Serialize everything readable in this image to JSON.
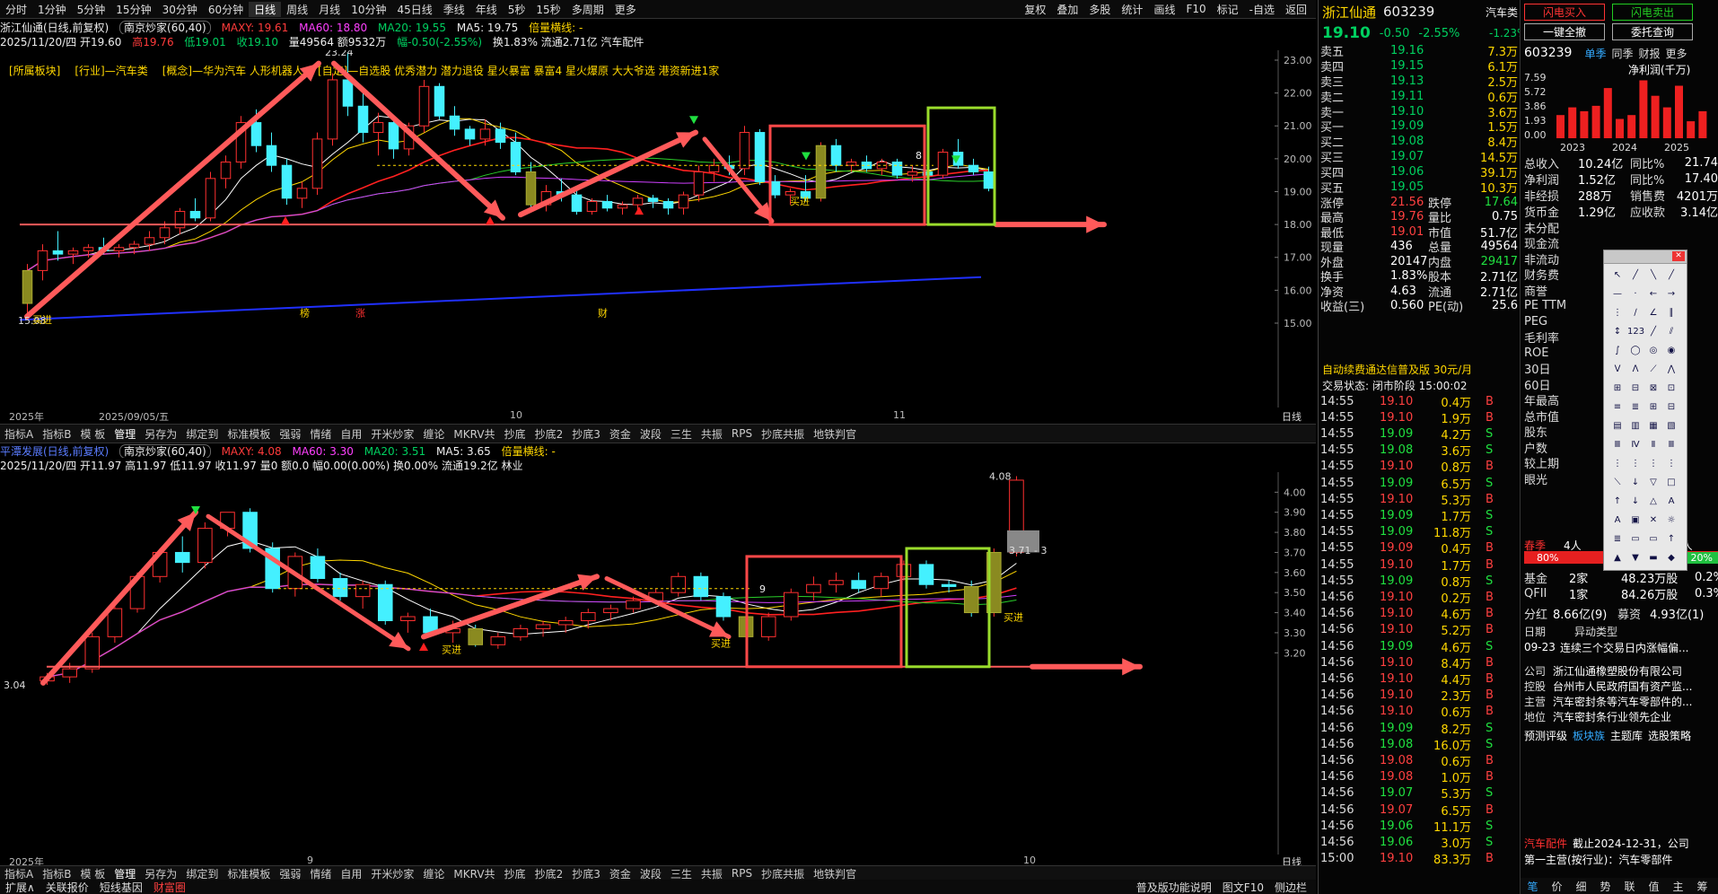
{
  "toolbar": {
    "periods": [
      "分时",
      "1分钟",
      "5分钟",
      "15分钟",
      "30分钟",
      "60分钟",
      "日线",
      "周线",
      "月线",
      "10分钟",
      "45日线",
      "季线",
      "年线",
      "5秒",
      "15秒",
      "多周期",
      "更多"
    ],
    "active_period": "日线",
    "right_items": [
      "复权",
      "叠加",
      "多股",
      "统计",
      "画线",
      "F10",
      "标记",
      "-自选",
      "返回"
    ]
  },
  "upper": {
    "title": "浙江仙通(日线,前复权)",
    "pill": "南京炒家(60,40)",
    "maxy": "MAXY: 19.61",
    "ma60": "MA60: 18.80",
    "ma20": "MA20: 19.55",
    "ma5": "MA5: 19.75",
    "beiliang": "倍量横线: -",
    "ohlc": "2025/11/20/四 开19.60",
    "high": "高19.76",
    "low": "低19.01",
    "close": "收19.10",
    "vol": "量49564 额9532万",
    "chg": "幅-0.50(-2.55%)",
    "extra": "换1.83% 流通2.71亿 汽车配件",
    "tags": [
      "[所属板块]",
      "[行业]—汽车类",
      "[概念]—华为汽车 人形机器人",
      "[自定]—自选股 优秀潜力 潜力退役 星火暴富 暴富4 星火爆原 大大爷选 港资新进1家"
    ],
    "yticks": [
      "23.00",
      "22.00",
      "21.00",
      "20.00",
      "19.00",
      "18.00",
      "17.00",
      "16.00",
      "15.00"
    ],
    "xlabels": [
      "2025年",
      "2025/09/05/五",
      "10",
      "11"
    ],
    "hi_label": "23.24",
    "lo_label": "15.08",
    "buy": "买进",
    "markers": [
      "榜",
      "涨",
      "财"
    ],
    "num8": "8",
    "day_label": "日线"
  },
  "tabs": [
    "指标A",
    "指标B",
    "模 板",
    "管理",
    "另存为",
    "绑定到",
    "标准模板",
    "强弱",
    "情绪",
    "自用",
    "开米炒家",
    "缠论",
    "MKRV共",
    "抄底",
    "抄底2",
    "抄底3",
    "资金",
    "波段",
    "三生",
    "共振",
    "RPS",
    "抄底共振",
    "地铁判官"
  ],
  "tabs_active": "管理",
  "lower": {
    "title": "平潭发展(日线,前复权)",
    "pill": "南京炒家(60,40)",
    "maxy": "MAXY: 4.08",
    "ma60": "MA60: 3.30",
    "ma20": "MA20: 3.51",
    "ma5": "MA5: 3.65",
    "beiliang": "倍量横线: -",
    "ohlc": "2025/11/20/四 开11.97 高11.97 低11.97 收11.97 量0 额0.0 幅0.00(0.00%) 换0.00% 流通19.2亿 林业",
    "yticks": [
      "4.00",
      "3.90",
      "3.80",
      "3.70",
      "3.60",
      "3.50",
      "3.40",
      "3.30",
      "3.20"
    ],
    "xlabels": [
      "2025年",
      "9",
      "10"
    ],
    "hi_label": "4.08",
    "lo_label": "3.04",
    "r_label": "3.71 - 3",
    "buy": "买进",
    "num9": "9",
    "day_label": "日线"
  },
  "bottom": {
    "items": [
      "扩展∧",
      "关联报价",
      "短线基因",
      "财富圈"
    ],
    "right": [
      "普及版功能说明",
      "图文F10",
      "侧边栏"
    ]
  },
  "quote": {
    "name": "浙江仙通",
    "code": "603239",
    "sector": "汽车类",
    "price": "19.10",
    "change": "-0.50",
    "pct": "-2.55%",
    "sector_pct": "-1.23%",
    "asks": [
      [
        "卖五",
        "19.16",
        "7.3万"
      ],
      [
        "卖四",
        "19.15",
        "6.1万"
      ],
      [
        "卖三",
        "19.13",
        "2.5万"
      ],
      [
        "卖二",
        "19.11",
        "0.6万"
      ],
      [
        "卖一",
        "19.10",
        "3.6万"
      ]
    ],
    "bids": [
      [
        "买一",
        "19.09",
        "1.5万"
      ],
      [
        "买二",
        "19.08",
        "8.4万"
      ],
      [
        "买三",
        "19.07",
        "14.5万"
      ],
      [
        "买四",
        "19.06",
        "39.1万"
      ],
      [
        "买五",
        "19.05",
        "10.3万"
      ]
    ],
    "stats": [
      [
        "涨停",
        "21.56",
        "跌停",
        "17.64"
      ],
      [
        "最高",
        "19.76",
        "量比",
        "0.75"
      ],
      [
        "最低",
        "19.01",
        "市值",
        "51.7亿"
      ],
      [
        "现量",
        "436",
        "总量",
        "49564"
      ],
      [
        "外盘",
        "20147",
        "内盘",
        "29417"
      ],
      [
        "换手",
        "1.83%",
        "股本",
        "2.71亿"
      ],
      [
        "净资",
        "4.63",
        "流通",
        "2.71亿"
      ],
      [
        "收益(三)",
        "0.560",
        "PE(动)",
        "25.6"
      ]
    ],
    "ad": "自动续费通达信普及版 30元/月",
    "status": "交易状态: 闭市阶段 15:00:02",
    "ticks": [
      [
        "14:55",
        "19.10",
        "0.4万",
        "B"
      ],
      [
        "14:55",
        "19.10",
        "1.9万",
        "B"
      ],
      [
        "14:55",
        "19.09",
        "4.2万",
        "S"
      ],
      [
        "14:55",
        "19.08",
        "3.6万",
        "S"
      ],
      [
        "14:55",
        "19.10",
        "0.8万",
        "B"
      ],
      [
        "14:55",
        "19.09",
        "6.5万",
        "S"
      ],
      [
        "14:55",
        "19.10",
        "5.3万",
        "B"
      ],
      [
        "14:55",
        "19.09",
        "1.7万",
        "S"
      ],
      [
        "14:55",
        "19.09",
        "11.8万",
        "S"
      ],
      [
        "14:55",
        "19.09",
        "0.4万",
        "B"
      ],
      [
        "14:55",
        "19.10",
        "1.7万",
        "B"
      ],
      [
        "14:55",
        "19.09",
        "0.8万",
        "S"
      ],
      [
        "14:56",
        "19.10",
        "0.2万",
        "B"
      ],
      [
        "14:56",
        "19.10",
        "4.6万",
        "B"
      ],
      [
        "14:56",
        "19.10",
        "5.2万",
        "B"
      ],
      [
        "14:56",
        "19.09",
        "4.6万",
        "S"
      ],
      [
        "14:56",
        "19.10",
        "8.4万",
        "B"
      ],
      [
        "14:56",
        "19.10",
        "4.4万",
        "B"
      ],
      [
        "14:56",
        "19.10",
        "2.3万",
        "B"
      ],
      [
        "14:56",
        "19.10",
        "0.6万",
        "B"
      ],
      [
        "14:56",
        "19.09",
        "8.2万",
        "S"
      ],
      [
        "14:56",
        "19.08",
        "16.0万",
        "S"
      ],
      [
        "14:56",
        "19.08",
        "0.6万",
        "B"
      ],
      [
        "14:56",
        "19.08",
        "1.0万",
        "B"
      ],
      [
        "14:56",
        "19.07",
        "5.3万",
        "S"
      ],
      [
        "14:56",
        "19.07",
        "6.5万",
        "B"
      ],
      [
        "14:56",
        "19.06",
        "11.1万",
        "S"
      ],
      [
        "14:56",
        "19.06",
        "3.0万",
        "S"
      ],
      [
        "15:00",
        "19.10",
        "83.3万",
        "B"
      ]
    ],
    "buttons": [
      "闪电买入",
      "闪电卖出",
      "一键全撤",
      "委托查询"
    ]
  },
  "f10": {
    "code": "603239",
    "tabs": [
      "单季",
      "同季",
      "财报",
      "更多"
    ],
    "chart_title": "净利润(千万)",
    "yvals": [
      "7.59",
      "5.72",
      "3.86",
      "1.93",
      "0.00"
    ],
    "years": [
      "2023",
      "2024",
      "2025"
    ],
    "rows": [
      [
        "总收入",
        "10.24亿",
        "同比%",
        "21.74"
      ],
      [
        "净利润",
        "1.52亿",
        "同比%",
        "17.40"
      ],
      [
        "非经损",
        "288万",
        "销售费",
        "4201万"
      ],
      [
        "货币金",
        "1.29亿",
        "应收款",
        "3.14亿"
      ]
    ],
    "left_labels": [
      "未分配",
      "现金流",
      "非流动",
      "财务费",
      "商誉",
      "PE TTM",
      "PEG",
      "毛利率",
      "ROE",
      "30日",
      "60日",
      "年最高",
      "总市值",
      "股东",
      "户数",
      "较上期",
      "眼光"
    ],
    "misc": [
      "春季",
      "4人",
      "1人",
      "80%",
      "20%"
    ],
    "holders": [
      [
        "基金",
        "2家",
        "48.23万股",
        "0.2%"
      ],
      [
        "QFII",
        "1家",
        "84.26万股",
        "0.3%"
      ]
    ],
    "fenhong": [
      "分红",
      "8.66亿(9)",
      "募资",
      "4.93亿(1)"
    ],
    "event_hdr": [
      "日期",
      "异动类型"
    ],
    "event": [
      "09-23",
      "连续三个交易日内涨幅偏..."
    ],
    "company": [
      [
        "公司",
        "浙江仙通橡塑股份有限公司"
      ],
      [
        "控股",
        "台州市人民政府国有资产监..."
      ],
      [
        "主营",
        "汽车密封条等汽车零部件的..."
      ],
      [
        "地位",
        "汽车密封条行业领先企业"
      ]
    ],
    "rating": [
      "预测评级",
      "板块族",
      "主题库",
      "选股策略"
    ],
    "foot": [
      "汽车配件",
      "截止2024-12-31，公司",
      "第一主营(按行业)：汽车零部件"
    ],
    "bottom_tabs": [
      "笔",
      "价",
      "细",
      "势",
      "联",
      "值",
      "主",
      "筹"
    ]
  },
  "chart_data": [
    {
      "type": "candlestick",
      "title": "浙江仙通(日线,前复权)",
      "ylim": [
        15.0,
        23.3
      ],
      "candles": [
        [
          15.6,
          16.8,
          15.1,
          16.6
        ],
        [
          16.6,
          17.4,
          16.3,
          17.2
        ],
        [
          17.2,
          17.8,
          16.9,
          17.1
        ],
        [
          17.1,
          17.3,
          16.8,
          17.2
        ],
        [
          17.2,
          17.4,
          17.0,
          17.3
        ],
        [
          17.3,
          17.6,
          17.1,
          17.2
        ],
        [
          17.2,
          17.4,
          17.0,
          17.3
        ],
        [
          17.3,
          17.5,
          17.1,
          17.4
        ],
        [
          17.4,
          17.8,
          17.2,
          17.6
        ],
        [
          17.6,
          18.1,
          17.4,
          17.9
        ],
        [
          17.9,
          18.5,
          17.7,
          18.4
        ],
        [
          18.4,
          18.8,
          18.1,
          18.2
        ],
        [
          18.2,
          19.6,
          18.1,
          19.4
        ],
        [
          19.4,
          20.1,
          19.1,
          19.9
        ],
        [
          19.9,
          21.3,
          19.7,
          21.1
        ],
        [
          21.1,
          21.5,
          20.2,
          20.4
        ],
        [
          20.4,
          20.8,
          19.6,
          19.8
        ],
        [
          19.8,
          20.0,
          18.6,
          18.8
        ],
        [
          18.8,
          19.3,
          18.5,
          19.1
        ],
        [
          19.1,
          20.8,
          18.9,
          20.6
        ],
        [
          20.6,
          22.6,
          20.4,
          22.4
        ],
        [
          22.4,
          23.24,
          21.3,
          21.6
        ],
        [
          21.6,
          22.1,
          20.5,
          20.8
        ],
        [
          20.8,
          21.4,
          20.1,
          21.1
        ],
        [
          21.1,
          21.2,
          20.0,
          20.3
        ],
        [
          20.3,
          21.1,
          20.1,
          21.0
        ],
        [
          21.0,
          22.4,
          20.8,
          22.2
        ],
        [
          22.2,
          22.3,
          21.2,
          21.3
        ],
        [
          21.3,
          21.6,
          20.7,
          20.9
        ],
        [
          20.9,
          21.0,
          20.4,
          20.6
        ],
        [
          20.6,
          21.2,
          20.4,
          20.9
        ],
        [
          20.9,
          21.1,
          20.3,
          20.5
        ],
        [
          20.5,
          20.8,
          19.5,
          19.6
        ],
        [
          19.6,
          19.9,
          18.5,
          18.6
        ],
        [
          18.6,
          19.2,
          18.4,
          19.0
        ],
        [
          19.0,
          19.4,
          18.7,
          18.9
        ],
        [
          18.9,
          19.1,
          18.3,
          18.4
        ],
        [
          18.4,
          18.8,
          18.3,
          18.7
        ],
        [
          18.7,
          18.9,
          18.4,
          18.5
        ],
        [
          18.5,
          18.7,
          18.3,
          18.6
        ],
        [
          18.6,
          18.9,
          18.4,
          18.8
        ],
        [
          18.8,
          18.9,
          18.5,
          18.7
        ],
        [
          18.7,
          18.8,
          18.3,
          18.5
        ],
        [
          18.5,
          19.0,
          18.3,
          18.9
        ],
        [
          18.9,
          19.8,
          18.7,
          19.6
        ],
        [
          19.6,
          20.0,
          19.3,
          19.8
        ],
        [
          19.8,
          20.1,
          19.5,
          19.7
        ],
        [
          19.7,
          21.0,
          19.5,
          20.8
        ],
        [
          20.8,
          20.9,
          19.2,
          19.3
        ],
        [
          19.3,
          19.5,
          18.8,
          18.9
        ],
        [
          18.9,
          19.1,
          18.6,
          19.0
        ],
        [
          19.0,
          19.5,
          18.7,
          18.8
        ],
        [
          18.8,
          20.5,
          18.7,
          20.4
        ],
        [
          20.4,
          20.6,
          19.6,
          19.8
        ],
        [
          19.8,
          20.0,
          19.6,
          19.9
        ],
        [
          19.9,
          20.1,
          19.6,
          19.7
        ],
        [
          19.7,
          20.0,
          19.5,
          19.9
        ],
        [
          19.9,
          20.0,
          19.4,
          19.5
        ],
        [
          19.5,
          19.8,
          19.3,
          19.6
        ],
        [
          19.6,
          19.9,
          19.3,
          19.5
        ],
        [
          19.5,
          20.3,
          19.4,
          20.2
        ],
        [
          20.2,
          20.6,
          19.7,
          19.8
        ],
        [
          19.8,
          20.0,
          19.5,
          19.6
        ],
        [
          19.6,
          19.76,
          19.01,
          19.1
        ]
      ],
      "ma_values": {
        "MA60": 18.8,
        "MA20": 19.55,
        "MA5": 19.75
      }
    },
    {
      "type": "candlestick",
      "title": "平潭发展(日线,前复权)",
      "ylim": [
        3.0,
        4.1
      ],
      "candles": [
        [
          3.06,
          3.1,
          3.04,
          3.08
        ],
        [
          3.08,
          3.15,
          3.05,
          3.12
        ],
        [
          3.12,
          3.3,
          3.1,
          3.28
        ],
        [
          3.28,
          3.45,
          3.25,
          3.42
        ],
        [
          3.42,
          3.6,
          3.4,
          3.58
        ],
        [
          3.58,
          3.72,
          3.55,
          3.7
        ],
        [
          3.7,
          3.78,
          3.6,
          3.65
        ],
        [
          3.65,
          3.85,
          3.62,
          3.82
        ],
        [
          3.82,
          3.9,
          3.78,
          3.9
        ],
        [
          3.9,
          3.92,
          3.7,
          3.72
        ],
        [
          3.72,
          3.75,
          3.5,
          3.52
        ],
        [
          3.52,
          3.7,
          3.48,
          3.68
        ],
        [
          3.68,
          3.72,
          3.55,
          3.57
        ],
        [
          3.57,
          3.6,
          3.46,
          3.48
        ],
        [
          3.48,
          3.56,
          3.42,
          3.54
        ],
        [
          3.54,
          3.56,
          3.34,
          3.36
        ],
        [
          3.36,
          3.4,
          3.3,
          3.38
        ],
        [
          3.38,
          3.42,
          3.28,
          3.3
        ],
        [
          3.3,
          3.36,
          3.25,
          3.32
        ],
        [
          3.32,
          3.34,
          3.23,
          3.24
        ],
        [
          3.24,
          3.3,
          3.22,
          3.28
        ],
        [
          3.28,
          3.34,
          3.26,
          3.32
        ],
        [
          3.32,
          3.36,
          3.28,
          3.34
        ],
        [
          3.34,
          3.38,
          3.3,
          3.36
        ],
        [
          3.36,
          3.42,
          3.32,
          3.4
        ],
        [
          3.4,
          3.44,
          3.36,
          3.42
        ],
        [
          3.42,
          3.48,
          3.4,
          3.46
        ],
        [
          3.46,
          3.52,
          3.44,
          3.5
        ],
        [
          3.5,
          3.6,
          3.48,
          3.58
        ],
        [
          3.58,
          3.6,
          3.46,
          3.48
        ],
        [
          3.48,
          3.5,
          3.36,
          3.38
        ],
        [
          3.38,
          3.42,
          3.26,
          3.28
        ],
        [
          3.28,
          3.4,
          3.26,
          3.38
        ],
        [
          3.38,
          3.52,
          3.36,
          3.5
        ],
        [
          3.5,
          3.58,
          3.46,
          3.54
        ],
        [
          3.54,
          3.6,
          3.5,
          3.56
        ],
        [
          3.56,
          3.6,
          3.5,
          3.52
        ],
        [
          3.52,
          3.6,
          3.48,
          3.58
        ],
        [
          3.58,
          3.66,
          3.56,
          3.64
        ],
        [
          3.64,
          3.66,
          3.52,
          3.54
        ],
        [
          3.54,
          3.56,
          3.5,
          3.53
        ],
        [
          3.53,
          3.56,
          3.38,
          3.4
        ],
        [
          3.4,
          3.72,
          3.38,
          3.7
        ],
        [
          3.7,
          4.08,
          3.68,
          4.06
        ]
      ],
      "ma_values": {
        "MA60": 3.3,
        "MA20": 3.51,
        "MA5": 3.65
      }
    }
  ]
}
